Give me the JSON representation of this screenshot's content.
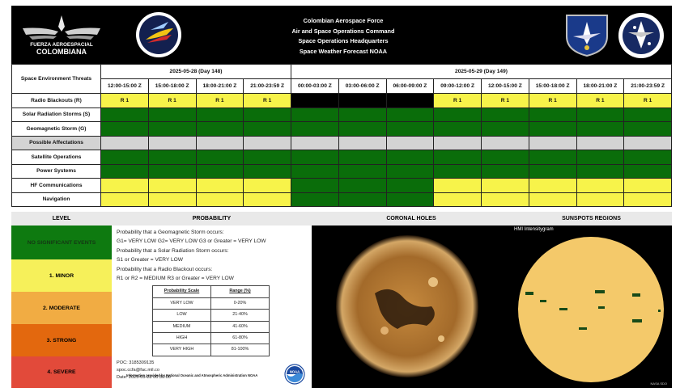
{
  "header": {
    "line1": "Colombian Aerospace Force",
    "line2": "Air and Space Operations Command",
    "line3": "Space Operations Headquarters",
    "line4": "Space Weather Forecast NOAA",
    "logo_left_line1": "FUERZA AEROESPACIAL",
    "logo_left_line2": "COLOMBIANA"
  },
  "grid": {
    "threats_label": "Space Environment Threats",
    "day1": "2025-05-28 (Day 148)",
    "day2": "2025-05-29 (Day 149)",
    "slots": [
      "12:00-15:00 Z",
      "15:00-18:00 Z",
      "18:00-21:00 Z",
      "21:00-23:59 Z",
      "00:00-03:00 Z",
      "03:00-06:00 Z",
      "06:00-09:00 Z",
      "09:00-12:00 Z",
      "12:00-15:00 Z",
      "15:00-18:00 Z",
      "18:00-21:00 Z",
      "21:00-23:59 Z"
    ],
    "rows": [
      {
        "label": "Radio Blackouts (R)",
        "cells": [
          "y",
          "y",
          "y",
          "y",
          "k",
          "k",
          "k",
          "y",
          "y",
          "y",
          "y",
          "y"
        ],
        "texts": [
          "R 1",
          "R 1",
          "R 1",
          "R 1",
          "",
          "",
          "",
          "R 1",
          "R 1",
          "R 1",
          "R 1",
          "R 1"
        ]
      },
      {
        "label": "Solar Radiation Storms (S)",
        "cells": [
          "g",
          "g",
          "g",
          "g",
          "g",
          "g",
          "g",
          "g",
          "g",
          "g",
          "g",
          "g"
        ],
        "texts": [
          "",
          "",
          "",
          "",
          "",
          "",
          "",
          "",
          "",
          "",
          "",
          ""
        ]
      },
      {
        "label": "Geomagnetic Storm (G)",
        "cells": [
          "g",
          "g",
          "g",
          "g",
          "g",
          "g",
          "g",
          "g",
          "g",
          "g",
          "g",
          "g"
        ],
        "texts": [
          "",
          "",
          "",
          "",
          "",
          "",
          "",
          "",
          "",
          "",
          "",
          ""
        ]
      },
      {
        "label": "Possible Affectations",
        "cells": [
          "gray",
          "gray",
          "gray",
          "gray",
          "gray",
          "gray",
          "gray",
          "gray",
          "gray",
          "gray",
          "gray",
          "gray"
        ],
        "texts": [
          "",
          "",
          "",
          "",
          "",
          "",
          "",
          "",
          "",
          "",
          "",
          ""
        ]
      },
      {
        "label": "Satellite Operations",
        "cells": [
          "g",
          "g",
          "g",
          "g",
          "g",
          "g",
          "g",
          "g",
          "g",
          "g",
          "g",
          "g"
        ],
        "texts": [
          "",
          "",
          "",
          "",
          "",
          "",
          "",
          "",
          "",
          "",
          "",
          ""
        ]
      },
      {
        "label": "Power Systems",
        "cells": [
          "g",
          "g",
          "g",
          "g",
          "g",
          "g",
          "g",
          "g",
          "g",
          "g",
          "g",
          "g"
        ],
        "texts": [
          "",
          "",
          "",
          "",
          "",
          "",
          "",
          "",
          "",
          "",
          "",
          ""
        ]
      },
      {
        "label": "HF Communications",
        "cells": [
          "y",
          "y",
          "y",
          "y",
          "g",
          "g",
          "g",
          "y",
          "y",
          "y",
          "y",
          "y"
        ],
        "texts": [
          "",
          "",
          "",
          "",
          "",
          "",
          "",
          "",
          "",
          "",
          "",
          ""
        ]
      },
      {
        "label": "Navigation",
        "cells": [
          "y",
          "y",
          "y",
          "y",
          "g",
          "g",
          "g",
          "y",
          "y",
          "y",
          "y",
          "y"
        ],
        "texts": [
          "",
          "",
          "",
          "",
          "",
          "",
          "",
          "",
          "",
          "",
          "",
          ""
        ]
      }
    ]
  },
  "colors": {
    "green": "#0a6d0a",
    "yellow": "#f7f34a",
    "black": "#000000",
    "gray": "#d3d3d3"
  },
  "levels": {
    "header": "LEVEL",
    "items": [
      {
        "label": "NO SIGNIFICANT EVENTS",
        "color": "#0e7a10"
      },
      {
        "label": "1. MINOR",
        "color": "#f6f05a"
      },
      {
        "label": "2. MODERATE",
        "color": "#f1ac43"
      },
      {
        "label": "3. STRONG",
        "color": "#e3680e"
      },
      {
        "label": "4. SEVERE",
        "color": "#e24a3a"
      }
    ]
  },
  "probability": {
    "header": "PROBABILITY",
    "line1": "Probability that a Geomagnetic Storm occurs:",
    "line2": "G1= VERY LOW G2= VERY LOW G3 or Greater = VERY LOW",
    "line3": "Probability that a Solar Radiation Storm occurs:",
    "line4": "S1 or Greater = VERY LOW",
    "line5": "Probability that a Radio Blackout occurs:",
    "line6": "R1 or R2 = MEDIUM R3 or Greater = VERY LOW",
    "scale_header": "Probability Scale",
    "range_header": "Range (%)",
    "scale": [
      {
        "name": "VERY LOW",
        "range": "0-20%"
      },
      {
        "name": "LOW",
        "range": "21-40%"
      },
      {
        "name": "MEDIUM",
        "range": "41-60%"
      },
      {
        "name": "HIGH",
        "range": "61-80%"
      },
      {
        "name": "VERY HIGH",
        "range": "81-100%"
      }
    ],
    "poc": "POC: 3185309135",
    "email": "spoc.ccfa@fac.mil.co",
    "date": "Date: 2025-05-28 00:30:00",
    "info": "Information provided by National Oceanic and Atmospheric Administration NOAA",
    "noaa_logo": "NOAA"
  },
  "coronal": {
    "header": "CORONAL HOLES"
  },
  "sunspots": {
    "header": "SUNSPOTS REGIONS",
    "caption": "HMI Intensitygram",
    "credit": "NASA SDO"
  }
}
